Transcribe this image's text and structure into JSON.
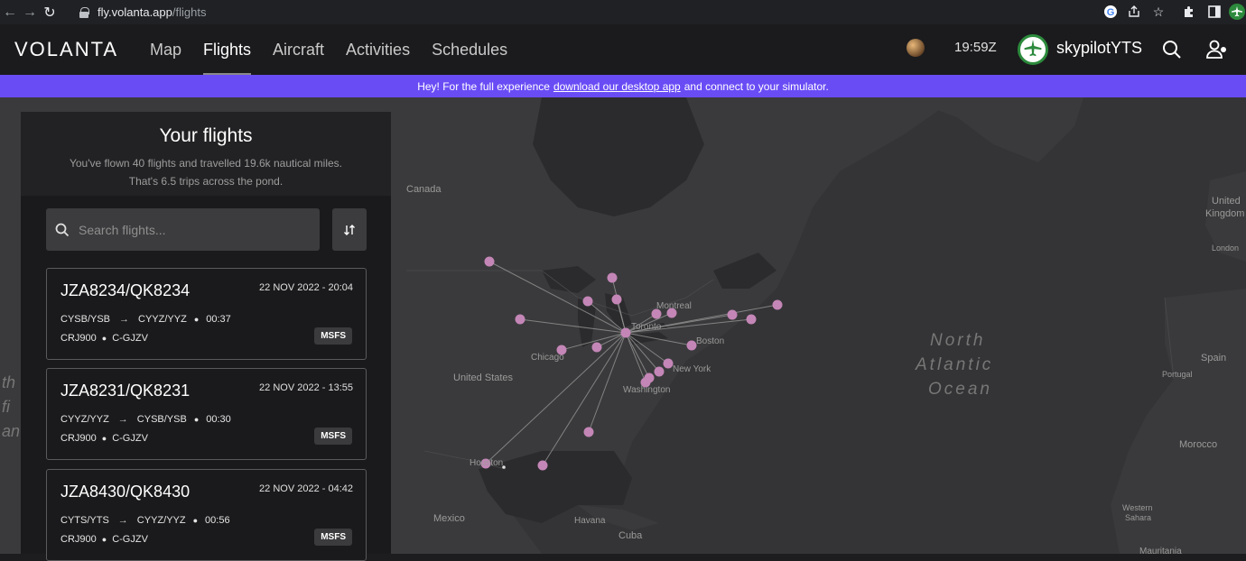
{
  "browser": {
    "url_host": "fly.volanta.app",
    "url_path": "/flights"
  },
  "header": {
    "logo": "VOLANTA",
    "nav": [
      {
        "label": "Map",
        "active": false
      },
      {
        "label": "Flights",
        "active": true
      },
      {
        "label": "Aircraft",
        "active": false
      },
      {
        "label": "Activities",
        "active": false
      },
      {
        "label": "Schedules",
        "active": false
      }
    ],
    "time": "19:59Z",
    "username": "skypilotYTS"
  },
  "banner": {
    "prefix": "Hey! For the full experience",
    "link": "download our desktop app",
    "suffix": "and connect to your simulator."
  },
  "panel": {
    "title": "Your flights",
    "subtitle_1": "You've flown 40 flights and travelled 19.6k nautical miles.",
    "subtitle_2": "That's 6.5 trips across the pond.",
    "search_placeholder": "Search flights..."
  },
  "flights": [
    {
      "code": "JZA8234/QK8234",
      "date": "22 NOV 2022 - 20:04",
      "from": "CYSB/YSB",
      "to": "CYYZ/YYZ",
      "duration": "00:37",
      "aircraft": "CRJ900",
      "registration": "C-GJZV",
      "sim": "MSFS"
    },
    {
      "code": "JZA8231/QK8231",
      "date": "22 NOV 2022 - 13:55",
      "from": "CYYZ/YYZ",
      "to": "CYSB/YSB",
      "duration": "00:30",
      "aircraft": "CRJ900",
      "registration": "C-GJZV",
      "sim": "MSFS"
    },
    {
      "code": "JZA8430/QK8430",
      "date": "22 NOV 2022 - 04:42",
      "from": "CYTS/YTS",
      "to": "CYYZ/YYZ",
      "duration": "00:56",
      "aircraft": "CRJ900",
      "registration": "C-GJZV",
      "sim": "MSFS"
    }
  ],
  "map": {
    "labels": {
      "canada": "Canada",
      "united_states": "United States",
      "mexico": "Mexico",
      "havana": "Havana",
      "cuba": "Cuba",
      "montreal": "Montreal",
      "toronto": "Toronto",
      "chicago": "Chicago",
      "boston": "Boston",
      "new_york": "New York",
      "washington": "Washington",
      "houston": "Houston",
      "north": "North",
      "atlantic": "Atlantic",
      "ocean": "Ocean",
      "united": "United",
      "kingdom": "Kingdom",
      "london": "London",
      "spain": "Spain",
      "portugal": "Portugal",
      "morocco": "Morocco",
      "western": "Western",
      "sahara": "Sahara",
      "mauritania": "Mauritania",
      "left_fragment_1": "th",
      "left_fragment_2": "fi",
      "left_fragment_3": "an"
    },
    "route_color": "#9b9b9b",
    "marker_color": "#c486b7"
  },
  "colors": {
    "banner": "#6a4cf5",
    "avatar_ring": "#2c8a3c"
  }
}
